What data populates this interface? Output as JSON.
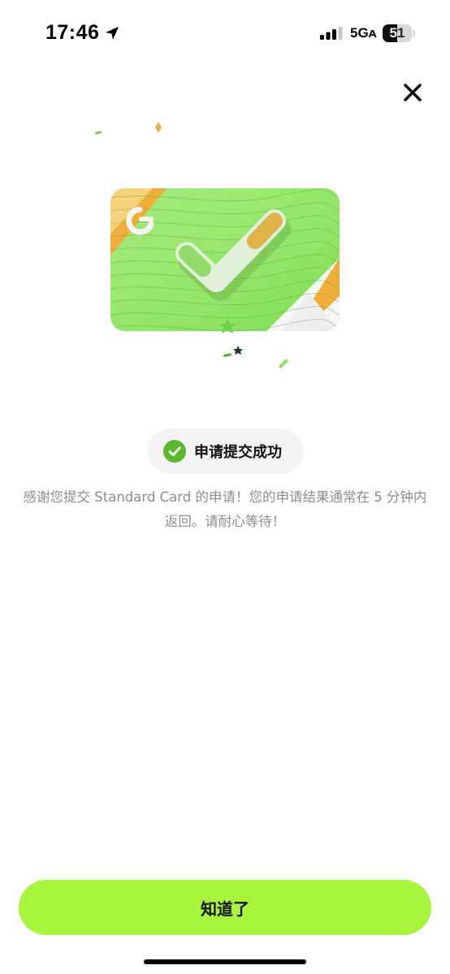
{
  "status_bar": {
    "time": "17:46",
    "network": "5Gᴀ",
    "battery": "51",
    "battery_level": 0.51,
    "location_icon": "location-arrow-icon",
    "signal_icon": "cellular-signal-icon"
  },
  "header": {
    "close_icon": "close-icon"
  },
  "illustration": {
    "icon": "card-with-checkmark-illustration",
    "colors": {
      "card_green": "#94e86a",
      "card_orange": "#f0ad3a",
      "checkmark_white": "#f5f7f2"
    }
  },
  "status": {
    "label": "申请提交成功",
    "icon": "check-circle-icon",
    "icon_color": "#5cb82e"
  },
  "message": {
    "text": "感谢您提交 Standard Card 的申请！您的申请结果通常在 5 分钟内返回。请耐心等待！"
  },
  "footer": {
    "button_label": "知道了",
    "button_color": "#a8f53b"
  }
}
